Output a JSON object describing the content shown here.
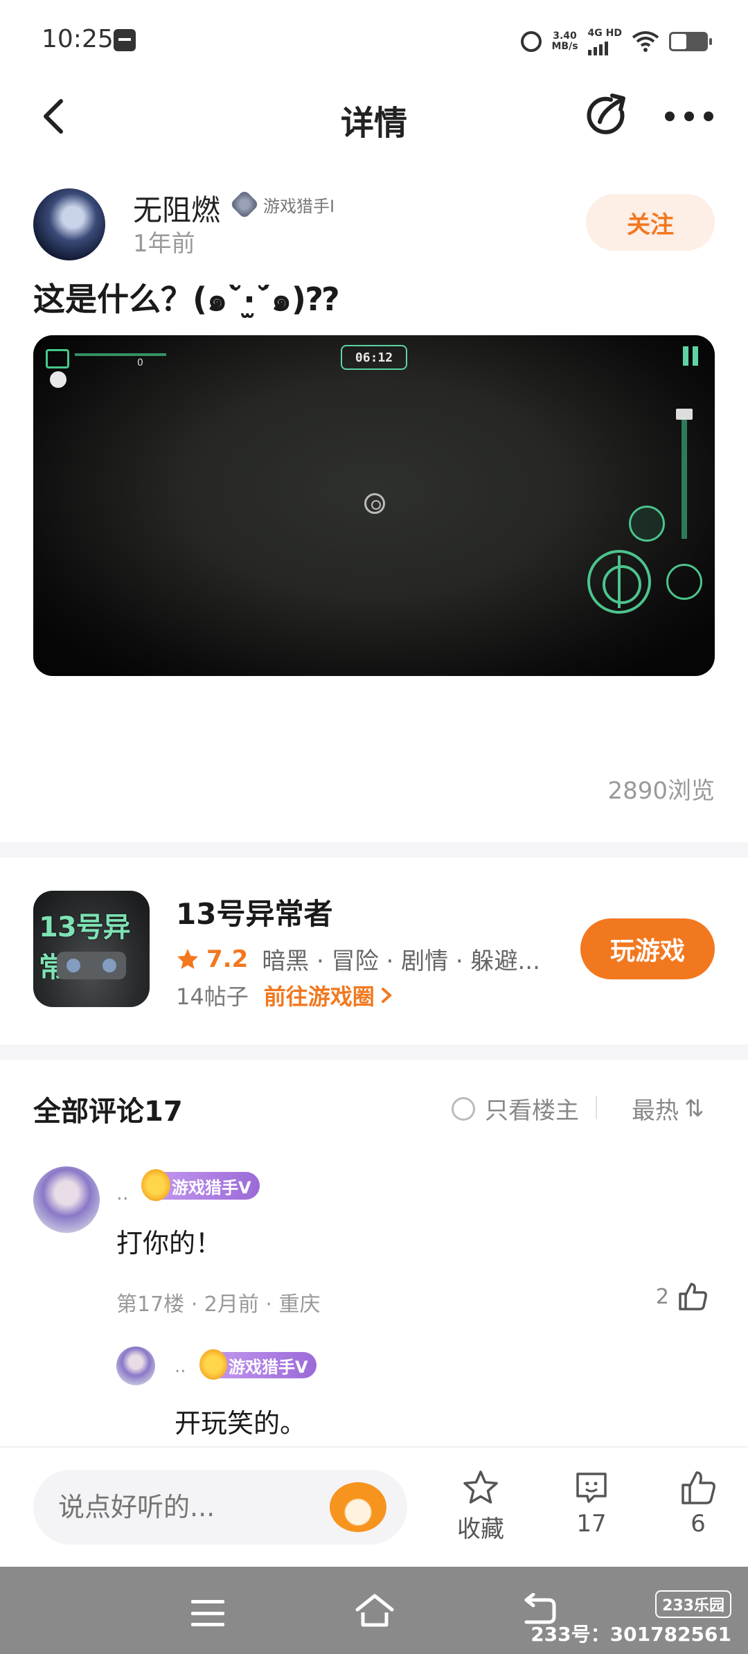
{
  "status_bar": {
    "time": "10:25",
    "net_speed_value": "3.40",
    "net_speed_unit": "MB/s",
    "network": "4G HD"
  },
  "header": {
    "title": "详情"
  },
  "post": {
    "author_name": "无阻燃",
    "author_badge": "游戏猎手I",
    "time": "1年前",
    "follow_label": "关注",
    "title": "这是什么？(๑˘̀·̫˘́๑)⁇",
    "views": "2890浏览",
    "screenshot_hud_timer": "06:12",
    "screenshot_hud_score": "0"
  },
  "game_card": {
    "name": "13号异常者",
    "icon_text": "13号异常",
    "rating": "7.2",
    "tags": "暗黑 · 冒险 · 剧情 · 躲避...",
    "posts": "14帖子",
    "goto_label": "前往游戏圈",
    "play_label": "玩游戏"
  },
  "comments": {
    "title": "全部评论17",
    "only_op_label": "只看楼主",
    "sort_label": "最热",
    "sort_icon": "⇅",
    "items": [
      {
        "name": "..",
        "badge": "游戏猎手V",
        "text": "打你的！",
        "meta": "第17楼 · 2月前 · 重庆",
        "likes": "2",
        "reply": {
          "name": "..",
          "badge": "游戏猎手V",
          "text": "开玩笑的。"
        }
      }
    ]
  },
  "bottom_bar": {
    "input_placeholder": "说点好听的...",
    "favorite_label": "收藏",
    "comment_count": "17",
    "like_count": "6"
  },
  "watermark": {
    "logo": "233乐园",
    "id_text": "233号：301782561"
  },
  "colors": {
    "accent": "#f2781f",
    "follow_bg": "#fdeee6",
    "badge_purple": "#9b6ad8",
    "hud_green": "#4cc48d"
  }
}
